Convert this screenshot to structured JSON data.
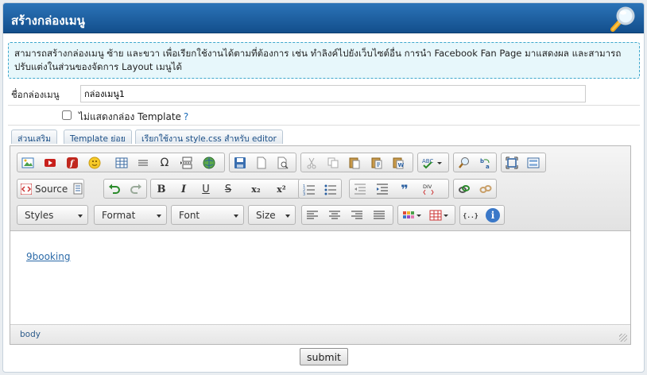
{
  "title": "สร้างกล่องเมนู",
  "notice": "สามารถสร้างกล่องเมนู ซ้าย และขวา เพื่อเรียกใช้งานได้ตามที่ต้องการ เช่น ทำลิงค์ไปยังเว็บไซต์อื่น การนำ Facebook Fan Page มาแสดงผล และสามารถปรับแต่งในส่วนของจัดการ Layout เมนูได้",
  "form": {
    "name_label": "ชื่อกล่องเมนู",
    "name_value": "กล่องเมนู1",
    "hide_template_label": "ไม่แสดงกล่อง Template",
    "hide_template_checked": false,
    "help_mark": "?"
  },
  "tabs": [
    "ส่วนเสริม",
    "Template ย่อย",
    "เรียกใช้งาน style.css สำหรับ editor"
  ],
  "toolbar": {
    "source_label": "Source",
    "combos": {
      "styles": "Styles",
      "format": "Format",
      "font": "Font",
      "size": "Size"
    },
    "icons": {
      "row1": [
        "image-icon",
        "youtube-icon",
        "flash-icon",
        "smiley-icon",
        "table-icon",
        "horizontal-rule-icon",
        "special-char-icon",
        "page-break-icon",
        "iframe-icon",
        "save-icon",
        "new-page-icon",
        "preview-icon",
        "cut-icon",
        "copy-icon",
        "paste-icon",
        "paste-text-icon",
        "paste-word-icon",
        "spellcheck-icon",
        "find-icon",
        "replace-icon",
        "maximize-icon",
        "show-blocks-icon"
      ],
      "row2": [
        "source-icon",
        "templates-icon",
        "undo-icon",
        "redo-icon",
        "bold-icon",
        "italic-icon",
        "underline-icon",
        "strike-icon",
        "subscript-icon",
        "superscript-icon",
        "numbered-list-icon",
        "bulleted-list-icon",
        "outdent-icon",
        "indent-icon",
        "blockquote-icon",
        "div-icon",
        "link-icon",
        "unlink-icon"
      ],
      "row3": [
        "align-left-icon",
        "align-center-icon",
        "align-right-icon",
        "justify-icon",
        "text-color-icon",
        "table-dropdown-icon",
        "code-icon",
        "about-icon"
      ]
    },
    "glyphs": {
      "special_char": "Ω",
      "bold": "B",
      "italic": "I",
      "underline": "U",
      "strike": "S",
      "subscript": "x₂",
      "superscript": "x²",
      "blockquote": "❞",
      "code": "{..}",
      "about": "i"
    }
  },
  "editor": {
    "link_text": "9booking",
    "status_path": "body"
  },
  "submit_label": "submit",
  "colors": {
    "title_bar": "#1b5e9e",
    "notice_bg": "#e7f7fb",
    "notice_border": "#3ea7cc"
  }
}
